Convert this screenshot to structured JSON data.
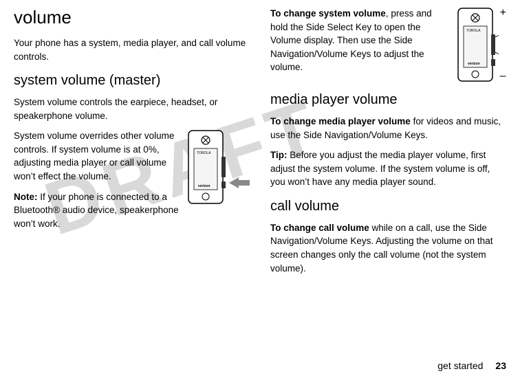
{
  "watermark": "DRAFT",
  "left": {
    "title": "volume",
    "intro": "Your phone has a system, media player, and call volume controls.",
    "sys_heading": "system volume (master)",
    "sys_p1": "System volume controls the earpiece, headset, or speakerphone volume.",
    "sys_p2": "System volume overrides other volume controls. If system volume is at 0%, adjusting media player or call volume won’t effect the volume.",
    "note_label": "Note:",
    "note_text": " If your phone is connected to a Bluetooth® audio device, speakerphone won’t work."
  },
  "right": {
    "change_sys_label": "To change system volume",
    "change_sys_text": ", press and hold the Side Select Key to open the Volume display. Then use the Side Navigation/Volume Keys to adjust the volume.",
    "media_heading": "media player volume",
    "change_media_label": "To change media player volume",
    "change_media_text": " for videos and music, use the Side Navigation/Volume Keys.",
    "tip_label": "Tip:",
    "tip_text": " Before you adjust the media player volume, first adjust the system volume. If the system volume is off, you won’t have any media player sound.",
    "call_heading": "call volume",
    "change_call_label": "To change call volume",
    "change_call_text": " while on a call, use the Side Navigation/Volume Keys. Adjusting the volume on that screen changes only the call volume (not the system volume)."
  },
  "diagram": {
    "plus": "+",
    "minus": "–",
    "brand_top": "TOROLA",
    "brand_bottom": "verizon"
  },
  "footer": {
    "label": "get started",
    "page": "23"
  }
}
